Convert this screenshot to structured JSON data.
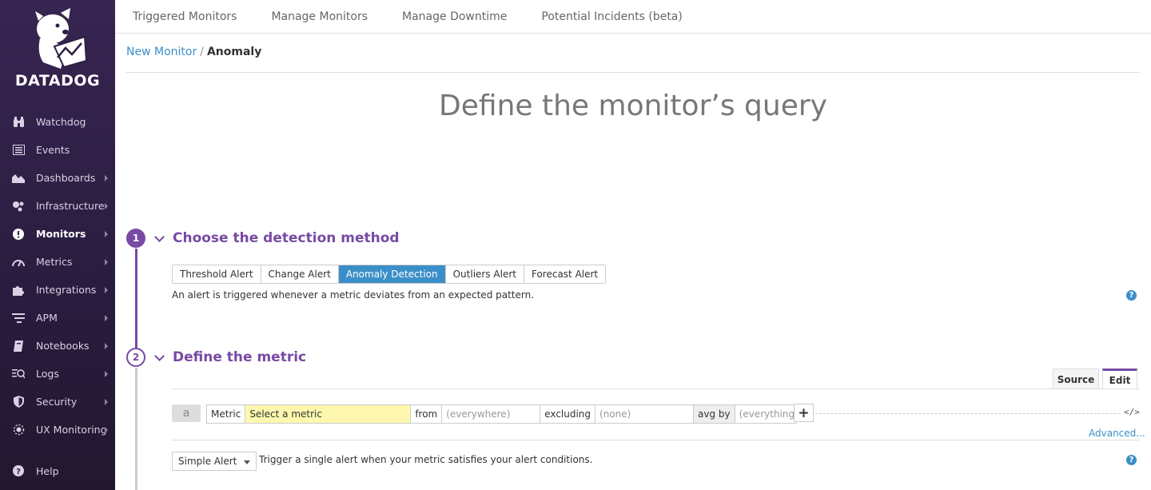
{
  "brand": {
    "name": "DATADOG"
  },
  "sidebar": {
    "items": [
      {
        "label": "Watchdog",
        "icon": "binoculars-icon",
        "has_submenu": false
      },
      {
        "label": "Events",
        "icon": "events-list-icon",
        "has_submenu": false
      },
      {
        "label": "Dashboards",
        "icon": "area-chart-icon",
        "has_submenu": true
      },
      {
        "label": "Infrastructure",
        "icon": "hexagon-nodes-icon",
        "has_submenu": true
      },
      {
        "label": "Monitors",
        "icon": "exclamation-circle-icon",
        "has_submenu": true,
        "active": true
      },
      {
        "label": "Metrics",
        "icon": "gauge-icon",
        "has_submenu": true
      },
      {
        "label": "Integrations",
        "icon": "puzzle-icon",
        "has_submenu": true
      },
      {
        "label": "APM",
        "icon": "apm-lines-icon",
        "has_submenu": true
      },
      {
        "label": "Notebooks",
        "icon": "notebook-icon",
        "has_submenu": true
      },
      {
        "label": "Logs",
        "icon": "logs-icon",
        "has_submenu": true
      },
      {
        "label": "Security",
        "icon": "shield-icon",
        "has_submenu": true
      },
      {
        "label": "UX Monitoring",
        "icon": "ux-gear-icon",
        "has_submenu": true
      }
    ],
    "help_label": "Help"
  },
  "topnav": {
    "tabs": [
      "Triggered Monitors",
      "Manage Monitors",
      "Manage Downtime",
      "Potential Incidents (beta)"
    ]
  },
  "breadcrumb": {
    "parent": "New Monitor",
    "separator": "/",
    "current": "Anomaly"
  },
  "page_title": "Define the monitor’s query",
  "step1": {
    "number": "1",
    "title": "Choose the detection method",
    "methods": [
      "Threshold Alert",
      "Change Alert",
      "Anomaly Detection",
      "Outliers Alert",
      "Forecast Alert"
    ],
    "selected": "Anomaly Detection",
    "description": "An alert is triggered whenever a metric deviates from an expected pattern."
  },
  "step2": {
    "number": "2",
    "title": "Define the metric",
    "tabs": {
      "source": "Source",
      "edit": "Edit"
    },
    "query": {
      "label": "a",
      "metric_label": "Metric",
      "metric_placeholder": "Select a metric",
      "from_label": "from",
      "from_value": "(everywhere)",
      "excluding_label": "excluding",
      "excluding_value": "(none)",
      "avg_label": "avg by",
      "avg_value": "(everything)",
      "add_symbol": "+",
      "code_symbol": "</>"
    },
    "advanced_label": "Advanced...",
    "alert_type": "Simple Alert",
    "alert_description": "Trigger a single alert when your metric satisfies your alert conditions."
  },
  "colors": {
    "accent": "#774aa4",
    "link": "#3b8fc8",
    "sidebar_bg": "#2f2145",
    "metric_highlight": "#fdf8ad"
  }
}
